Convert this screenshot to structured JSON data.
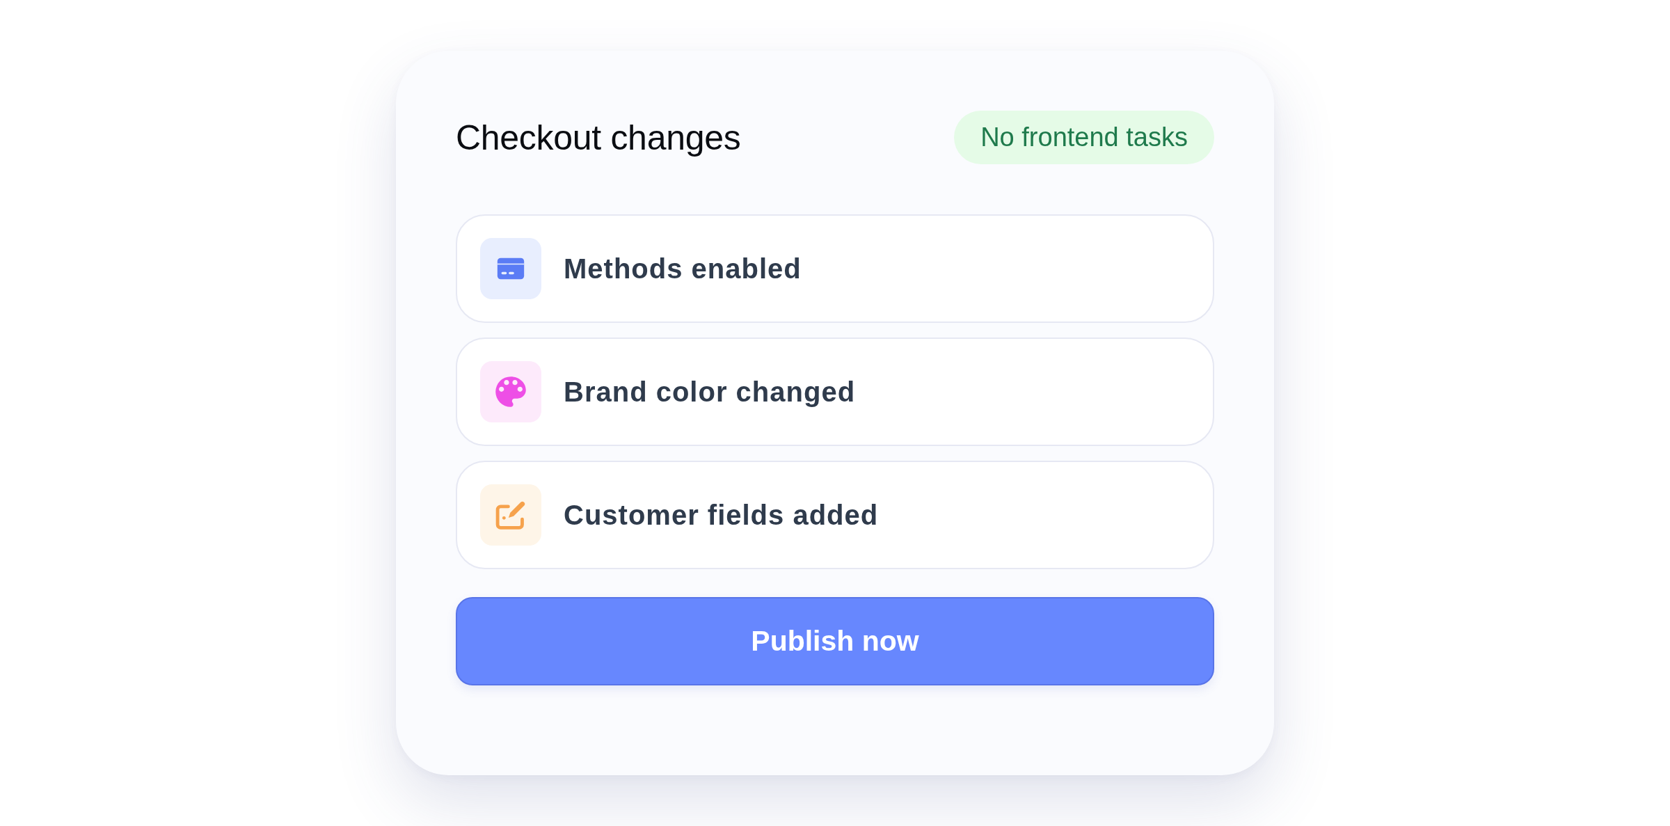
{
  "card": {
    "title": "Checkout changes",
    "badge": "No frontend tasks"
  },
  "changes": [
    {
      "label": "Methods enabled",
      "kind": "card"
    },
    {
      "label": "Brand color changed",
      "kind": "palette"
    },
    {
      "label": "Customer fields added",
      "kind": "edit"
    }
  ],
  "button": {
    "label": "Publish now"
  }
}
